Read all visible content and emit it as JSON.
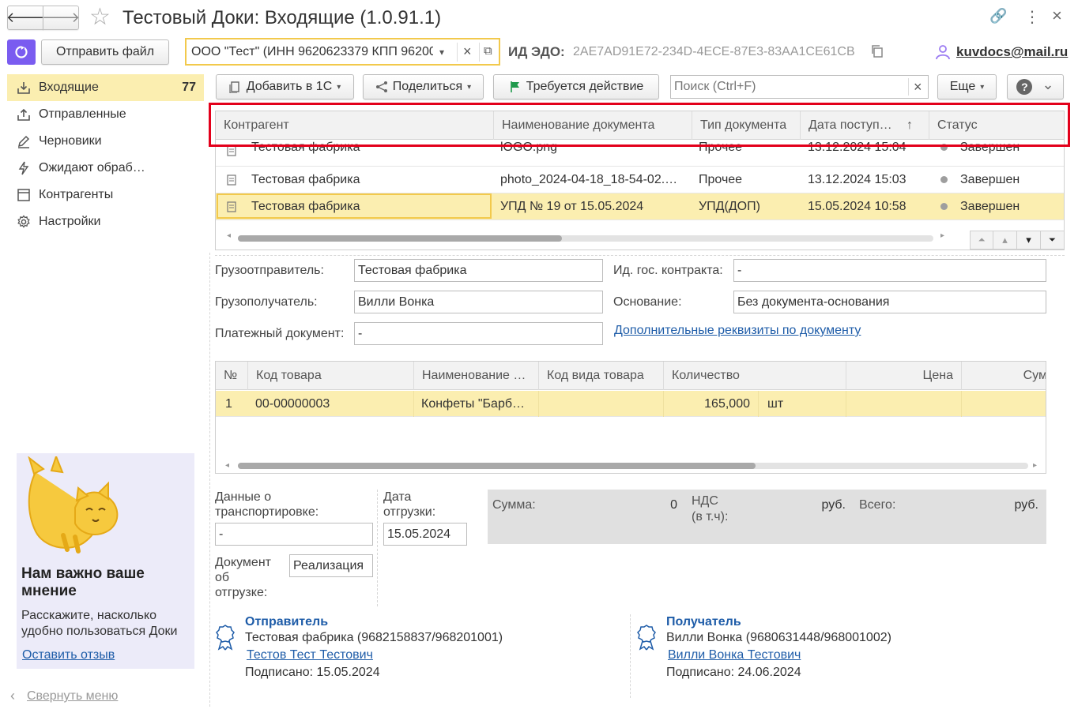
{
  "window": {
    "title": "Тестовый Доки: Входящие (1.0.91.1)",
    "back_glyph": "🡐",
    "forward_glyph": "🡒",
    "star_glyph": "☆",
    "link_glyph": "🔗",
    "more_glyph": "⋮",
    "close_glyph": "×"
  },
  "topbar": {
    "send_file_label": "Отправить файл",
    "org_value": "ООО \"Тест\" (ИНН 9620623379 КПП 96200",
    "org_caret": "▾",
    "org_clear": "×",
    "org_open": "⧉",
    "edo_label": "ИД ЭДО:",
    "edo_value": "2AE7AD91E72-234D-4ECE-87E3-83AA1CE61CB",
    "user_email": "kuvdocs@mail.ru"
  },
  "sidebar": {
    "items": [
      {
        "label": "Входящие",
        "badge": "77"
      },
      {
        "label": "Отправленные"
      },
      {
        "label": "Черновики"
      },
      {
        "label": "Ожидают обраб…"
      },
      {
        "label": "Контрагенты"
      },
      {
        "label": "Настройки"
      }
    ],
    "feedback": {
      "title": "Нам важно ваше мнение",
      "text": "Расскажите, насколько удобно пользоваться Доки",
      "link": "Оставить отзыв"
    },
    "collapse_label": "Свернуть меню"
  },
  "toolbar": {
    "add_label": "Добавить в 1С",
    "share_label": "Поделиться",
    "action_label": "Требуется действие",
    "search_placeholder": "Поиск (Ctrl+F)",
    "search_clear": "×",
    "more_label": "Еще",
    "help_glyph": "?",
    "caret": "▾",
    "chevron_down": "⌄"
  },
  "docs_table": {
    "columns": [
      "Контрагент",
      "Наименование документа",
      "Тип документа",
      "Дата поступ…",
      "Статус"
    ],
    "sort_glyph": "↑",
    "rows": [
      {
        "counterparty": "Тестовая фабрика",
        "doc_name": "lOGO.png",
        "doc_type": "Прочее",
        "date": "13.12.2024 15:04",
        "status": "Завершен"
      },
      {
        "counterparty": "Тестовая фабрика",
        "doc_name": "photo_2024-04-18_18-54-02.…",
        "doc_type": "Прочее",
        "date": "13.12.2024 15:03",
        "status": "Завершен"
      },
      {
        "counterparty": "Тестовая фабрика",
        "doc_name": "УПД № 19 от 15.05.2024",
        "doc_type": "УПД(ДОП)",
        "date": "15.05.2024 10:58",
        "status": "Завершен"
      }
    ],
    "nav": [
      "⏶",
      "▴",
      "▾",
      "⏷"
    ],
    "scroll_left": "◂",
    "scroll_right": "▸"
  },
  "details": {
    "shipper_label": "Грузоотправитель:",
    "shipper_value": "Тестовая фабрика",
    "consignee_label": "Грузополучатель:",
    "consignee_value": "Вилли Вонка",
    "payment_label": "Платежный документ:",
    "payment_value": "-",
    "contract_label": "Ид. гос. контракта:",
    "contract_value": "-",
    "basis_label": "Основание:",
    "basis_value": "Без документа-основания",
    "extra_link": "Дополнительные реквизиты по документу"
  },
  "goods_table": {
    "columns": [
      "№",
      "Код товара",
      "Наименование …",
      "Код вида товара",
      "Количество",
      "Цена",
      "Сум"
    ],
    "rows": [
      {
        "num": "1",
        "code": "00-00000003",
        "name": "Конфеты \"Барб…",
        "kind": "",
        "qty": "165,000",
        "unit": "шт",
        "price": "",
        "sum": ""
      }
    ],
    "scroll_left": "◂",
    "scroll_right": "▸"
  },
  "shipment": {
    "transport_label": "Данные о транспортировке:",
    "transport_value": "-",
    "ship_date_label": "Дата отгрузки:",
    "ship_date_value": "15.05.2024",
    "ship_doc_label": "Документ об отгрузке:",
    "ship_doc_value": "Реализация"
  },
  "totals": {
    "sum_label": "Сумма:",
    "sum_value": "0",
    "vat_label": "НДС (в т.ч):",
    "vat_value": "руб.",
    "total_label": "Всего:",
    "total_value": "руб."
  },
  "signatures": {
    "sender": {
      "title": "Отправитель",
      "org": "Тестовая фабрика (9682158837/968201001)",
      "person": "Тестов Тест Тестович",
      "signed": "Подписано: 15.05.2024"
    },
    "recipient": {
      "title": "Получатель",
      "org": "Вилли Вонка (9680631448/968001002)",
      "person": "Вилли Вонка Тестович",
      "signed": "Подписано: 24.06.2024"
    }
  },
  "colors": {
    "accent_yellow": "#fbeeb0",
    "link_blue": "#1e5ca8",
    "highlight_red": "#e3001b",
    "app_icon": "#7a5cf0"
  }
}
